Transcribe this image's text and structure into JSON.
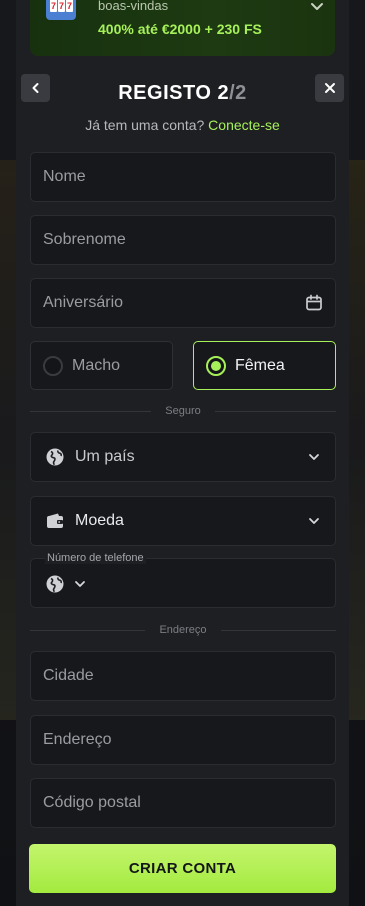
{
  "promo": {
    "top_text": "boas-vindas",
    "bonus_text": "400% até €2000 + 230 FS",
    "icon": "slot-machine-777-icon"
  },
  "header": {
    "title": "REGISTO",
    "step": "2",
    "slash": "/",
    "total": "2",
    "back_icon": "chevron-left-icon",
    "close_icon": "close-icon"
  },
  "login_prompt": {
    "text": "Já tem uma conta? ",
    "link": "Conecte-se"
  },
  "fields": {
    "first_name": "Nome",
    "last_name": "Sobrenome",
    "birthday": "Aniversário",
    "city": "Cidade",
    "address": "Endereço",
    "postal_code": "Código postal"
  },
  "gender": {
    "male": "Macho",
    "female": "Fêmea",
    "selected": "female"
  },
  "section_secure": "Seguro",
  "country_select": {
    "label": "Um país",
    "icon": "globe-icon"
  },
  "currency_select": {
    "label": "Moeda",
    "icon": "wallet-icon"
  },
  "phone": {
    "label": "Número de telefone",
    "country_icon": "globe-icon"
  },
  "section_address": "Endereço",
  "submit": "CRIAR CONTA",
  "colors": {
    "accent": "#a6f05a",
    "modal_bg": "#1e1f23",
    "input_bg": "#17181b",
    "promo_bg": "#1d3a12"
  }
}
